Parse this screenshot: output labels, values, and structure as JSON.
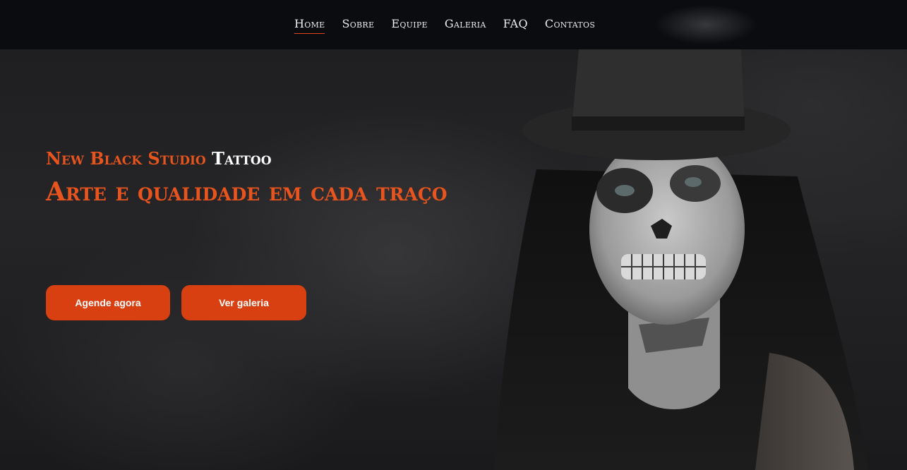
{
  "nav": {
    "items": [
      {
        "label": "Home",
        "active": true
      },
      {
        "label": "Sobre",
        "active": false
      },
      {
        "label": "Equipe",
        "active": false
      },
      {
        "label": "Galeria",
        "active": false
      },
      {
        "label": "FAQ",
        "active": false
      },
      {
        "label": "Contatos",
        "active": false
      }
    ]
  },
  "hero": {
    "brand_name": "New Black Studio",
    "brand_suffix": "Tattoo",
    "tagline": "Arte e qualidade em cada traço",
    "primary_button": "Agende agora",
    "secondary_button": "Ver galeria"
  },
  "colors": {
    "accent": "#e8541d",
    "button": "#d94011",
    "navbar": "#0b0c10",
    "background": "#1e1e21"
  }
}
